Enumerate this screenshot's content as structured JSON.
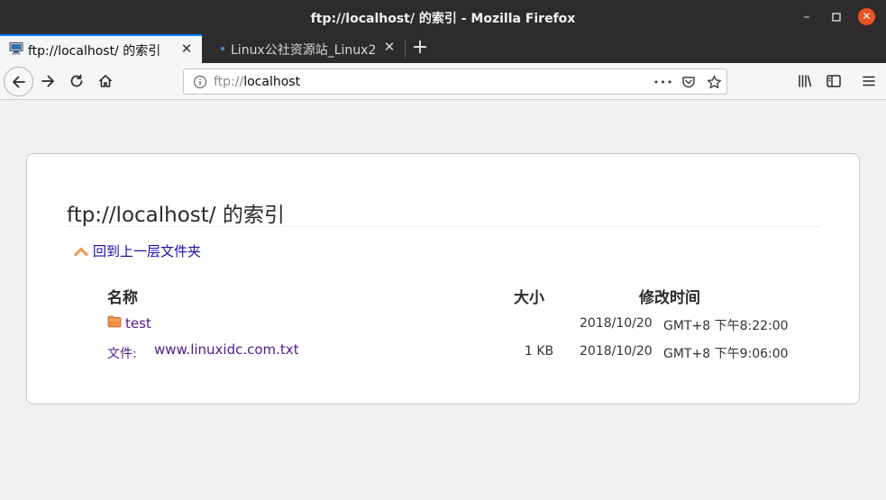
{
  "window": {
    "title": "ftp://localhost/ 的索引 - Mozilla Firefox",
    "controls": {
      "minimize": "–",
      "maximize": "□",
      "close": "✕"
    }
  },
  "tabs": [
    {
      "label": "ftp://localhost/ 的索引",
      "active": true,
      "close": "✕"
    },
    {
      "label": "Linux公社资源站_Linux2",
      "active": false,
      "close": "✕"
    }
  ],
  "new_tab": "+",
  "urlbar": {
    "scheme": "ftp://",
    "host": "localhost",
    "more": "•••"
  },
  "page": {
    "title": "ftp://localhost/ 的索引",
    "up_link": "回到上一层文件夹",
    "columns": {
      "name": "名称",
      "size": "大小",
      "modified": "修改时间"
    },
    "rows": [
      {
        "prefix": "",
        "name": "test",
        "size": "",
        "date": "2018/10/20",
        "time": "GMT+8 下午8:22:00",
        "icon": "folder-icon"
      },
      {
        "prefix": "文件:",
        "name": "www.linuxidc.com.txt",
        "size": "1 KB",
        "date": "2018/10/20",
        "time": "GMT+8 下午9:06:00",
        "icon": ""
      }
    ]
  },
  "colors": {
    "accent": "#0a84ff",
    "close_button": "#e95420",
    "link": "#551a8b",
    "up_link": "#1a0dab",
    "folder": "#f08d49"
  }
}
